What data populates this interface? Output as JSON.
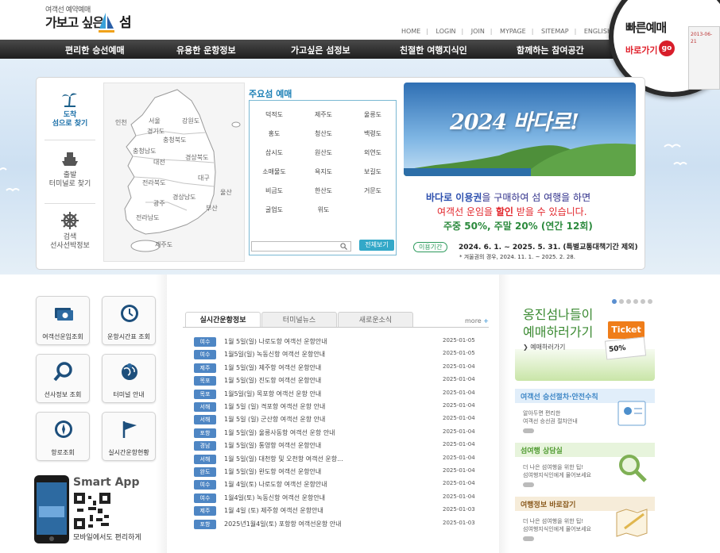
{
  "header": {
    "logo_small": "여객선 예약예매",
    "logo_main": "가보고 싶은",
    "logo_seom": "섬",
    "util_nav": [
      "HOME",
      "LOGIN",
      "JOIN",
      "MYPAGE",
      "SITEMAP",
      "ENGLISH"
    ]
  },
  "main_nav": [
    "편리한 승선예매",
    "유용한 운항정보",
    "가고싶은 섬정보",
    "친절한 여행지식인",
    "함께하는 참여공간"
  ],
  "quick": {
    "title": "빠른예매",
    "go_label": "바로가기",
    "go_button": "go",
    "ticket_text": "2013-06-21"
  },
  "side_menu": [
    {
      "label1": "도착",
      "label2": "섬으로 찾기",
      "icon": "palm-tree-icon"
    },
    {
      "label1": "출발",
      "label2": "터미널로 찾기",
      "icon": "ship-icon"
    },
    {
      "label1": "검색",
      "label2": "선사선박정보",
      "icon": "ship-wheel-icon"
    }
  ],
  "map_labels": [
    "인천",
    "서울",
    "경기도",
    "강원도",
    "충청북도",
    "충청남도",
    "대전",
    "경상북도",
    "대구",
    "전라북도",
    "울산",
    "경상남도",
    "광주",
    "부산",
    "전라남도",
    "제주도"
  ],
  "island_section": {
    "title": "주요섬 예매",
    "islands": [
      "덕적도",
      "제주도",
      "울릉도",
      "홍도",
      "청산도",
      "백령도",
      "삽시도",
      "원산도",
      "외연도",
      "소매물도",
      "욕지도",
      "보길도",
      "비금도",
      "한산도",
      "거문도",
      "굴업도",
      "위도"
    ],
    "all_button": "전체보기"
  },
  "promo": {
    "headline": "2024 바다로!",
    "line1_a": "바다로 이용권",
    "line1_b": "을 구매하여 섬 여행을 하면",
    "line2_a": "여객선 운임을 ",
    "line2_b": "할인",
    "line2_c": " 받을 수 있습니다.",
    "line3": "주중 50%, 주말 20% (연간 12회)",
    "period_tag": "이용기간",
    "period": "2024. 6. 1. ~ 2025. 5. 31. (특별교통대책기간 제외)",
    "period_note": "* 겨울권의 경우, 2024. 11. 1. ~ 2025. 2. 28."
  },
  "quick_buttons": [
    {
      "label": "여객선운임조회",
      "icon": "money-icon"
    },
    {
      "label": "운항시간표 조회",
      "icon": "clock-icon"
    },
    {
      "label": "선사정보 조회",
      "icon": "magnifier-icon"
    },
    {
      "label": "터미널 안내",
      "icon": "globe-pin-icon"
    },
    {
      "label": "항로조회",
      "icon": "compass-icon"
    },
    {
      "label": "실시간운항현황",
      "icon": "flag-icon"
    }
  ],
  "app": {
    "title": "Smart App",
    "subtitle": "모바일에서도 편리하게"
  },
  "tabs": [
    "실시간운항정보",
    "터미널뉴스",
    "새로운소식"
  ],
  "more": "more",
  "news": [
    {
      "badge": "여수",
      "title": "1월 5일(일) 나로도항 여객선 운항안내",
      "date": "2025-01-05"
    },
    {
      "badge": "여수",
      "title": "1월5일(일) 녹동신항 여객선 운항안내",
      "date": "2025-01-05"
    },
    {
      "badge": "제주",
      "title": "1월 5일(일) 제주항 여객선 운항안내",
      "date": "2025-01-04"
    },
    {
      "badge": "목포",
      "title": "1월 5일(일) 진도항 여객선 운항안내",
      "date": "2025-01-04"
    },
    {
      "badge": "목포",
      "title": "1월5일(일) 목포항 여객선 운항 안내",
      "date": "2025-01-04"
    },
    {
      "badge": "서해",
      "title": "1월 5일 (일) 격포항 여객선 운항 안내",
      "date": "2025-01-04"
    },
    {
      "badge": "서해",
      "title": "1월 5일 (일) 군산항 여객선 운항 안내",
      "date": "2025-01-04"
    },
    {
      "badge": "포항",
      "title": "1월 5일(일) 울릉사동항 여객선 운항 안내",
      "date": "2025-01-04"
    },
    {
      "badge": "경남",
      "title": "1월 5일(일) 통영항 여객선 운항안내",
      "date": "2025-01-04"
    },
    {
      "badge": "서해",
      "title": "1월 5일(일) 대천항 및 오천항 여객선 운항...",
      "date": "2025-01-04"
    },
    {
      "badge": "완도",
      "title": "1월 5일(일) 완도항 여객선 운항안내",
      "date": "2025-01-04"
    },
    {
      "badge": "여수",
      "title": "1월 4일(토) 나로도항 여객선 운항안내",
      "date": "2025-01-04"
    },
    {
      "badge": "여수",
      "title": "1월4일(토) 녹동신항 여객선 운항안내",
      "date": "2025-01-04"
    },
    {
      "badge": "제주",
      "title": "1월 4일 (토) 제주항 여객선 운항안내",
      "date": "2025-01-03"
    },
    {
      "badge": "포항",
      "title": "2025년1월4일(토) 포항항 여객선운항 안내",
      "date": "2025-01-03"
    }
  ],
  "right_banner": {
    "title1": "옹진섬나들이",
    "title2": "예매하러가기",
    "link": "예매하러가기",
    "ticket_label": "Ticket",
    "ticket_discount": "50%"
  },
  "info_boxes": [
    {
      "head": "여객선 승선절차·안전수칙",
      "body1": "알아두면 편리한",
      "body2": "여객선 승선권 절차안내",
      "color": "#3d86c6",
      "bg": "#e1eefa"
    },
    {
      "head": "섬여행 상담실",
      "body1": "더 나은 섬여행을 위한 팁!",
      "body2": "섬여행지식인에게 물어보세요",
      "color": "#4f9a30",
      "bg": "#e7f4dc"
    },
    {
      "head": "여행정보 바로잡기",
      "body1": "더 나은 섬여행을 위한 팁!",
      "body2": "섬여행지식인에게 물어보세요",
      "color": "#8a5a1e",
      "bg": "#f6ecd9"
    }
  ]
}
